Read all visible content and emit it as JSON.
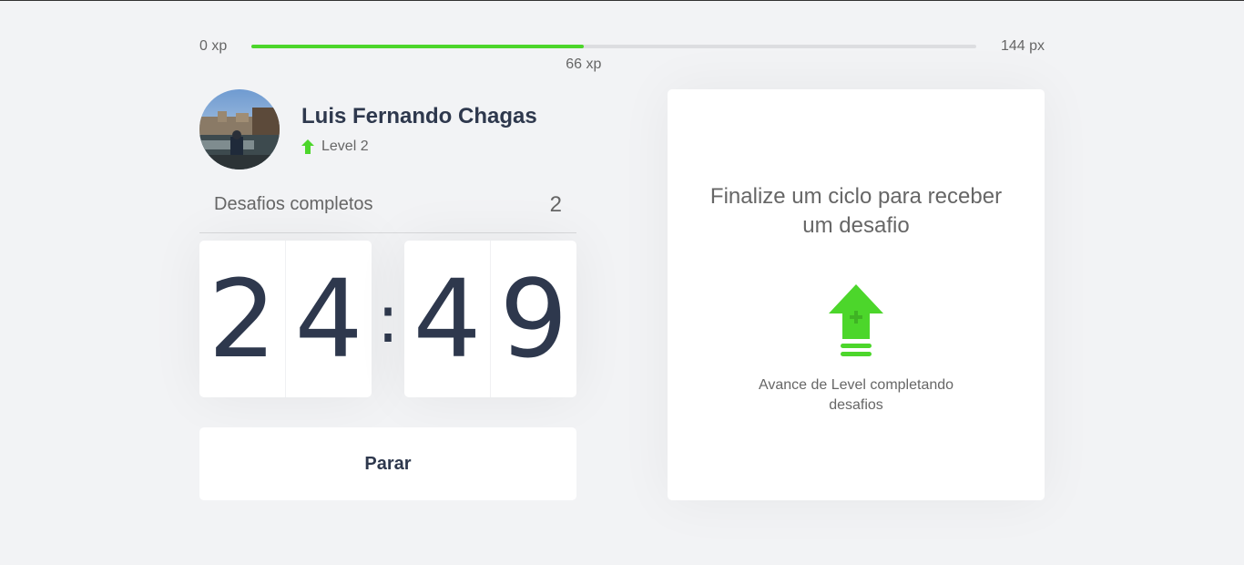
{
  "xp": {
    "min_label": "0 xp",
    "max_label": "144 px",
    "current_label": "66 xp",
    "current": 66,
    "max": 144,
    "fill_color": "#4cd62b"
  },
  "profile": {
    "name": "Luis Fernando Chagas",
    "level_label": "Level 2"
  },
  "completed": {
    "label": "Desafios completos",
    "count": "2"
  },
  "countdown": {
    "minute_left": "2",
    "minute_right": "4",
    "separator": ":",
    "second_left": "4",
    "second_right": "9"
  },
  "stop_button": {
    "label": "Parar"
  },
  "challenge": {
    "title": "Finalize um ciclo para receber um desafio",
    "icon": "level-up-icon",
    "text": "Avance de Level completando desafios"
  },
  "colors": {
    "accent": "#4cd62b",
    "title": "#2e384d",
    "text": "#666666",
    "background": "#f2f3f5"
  }
}
